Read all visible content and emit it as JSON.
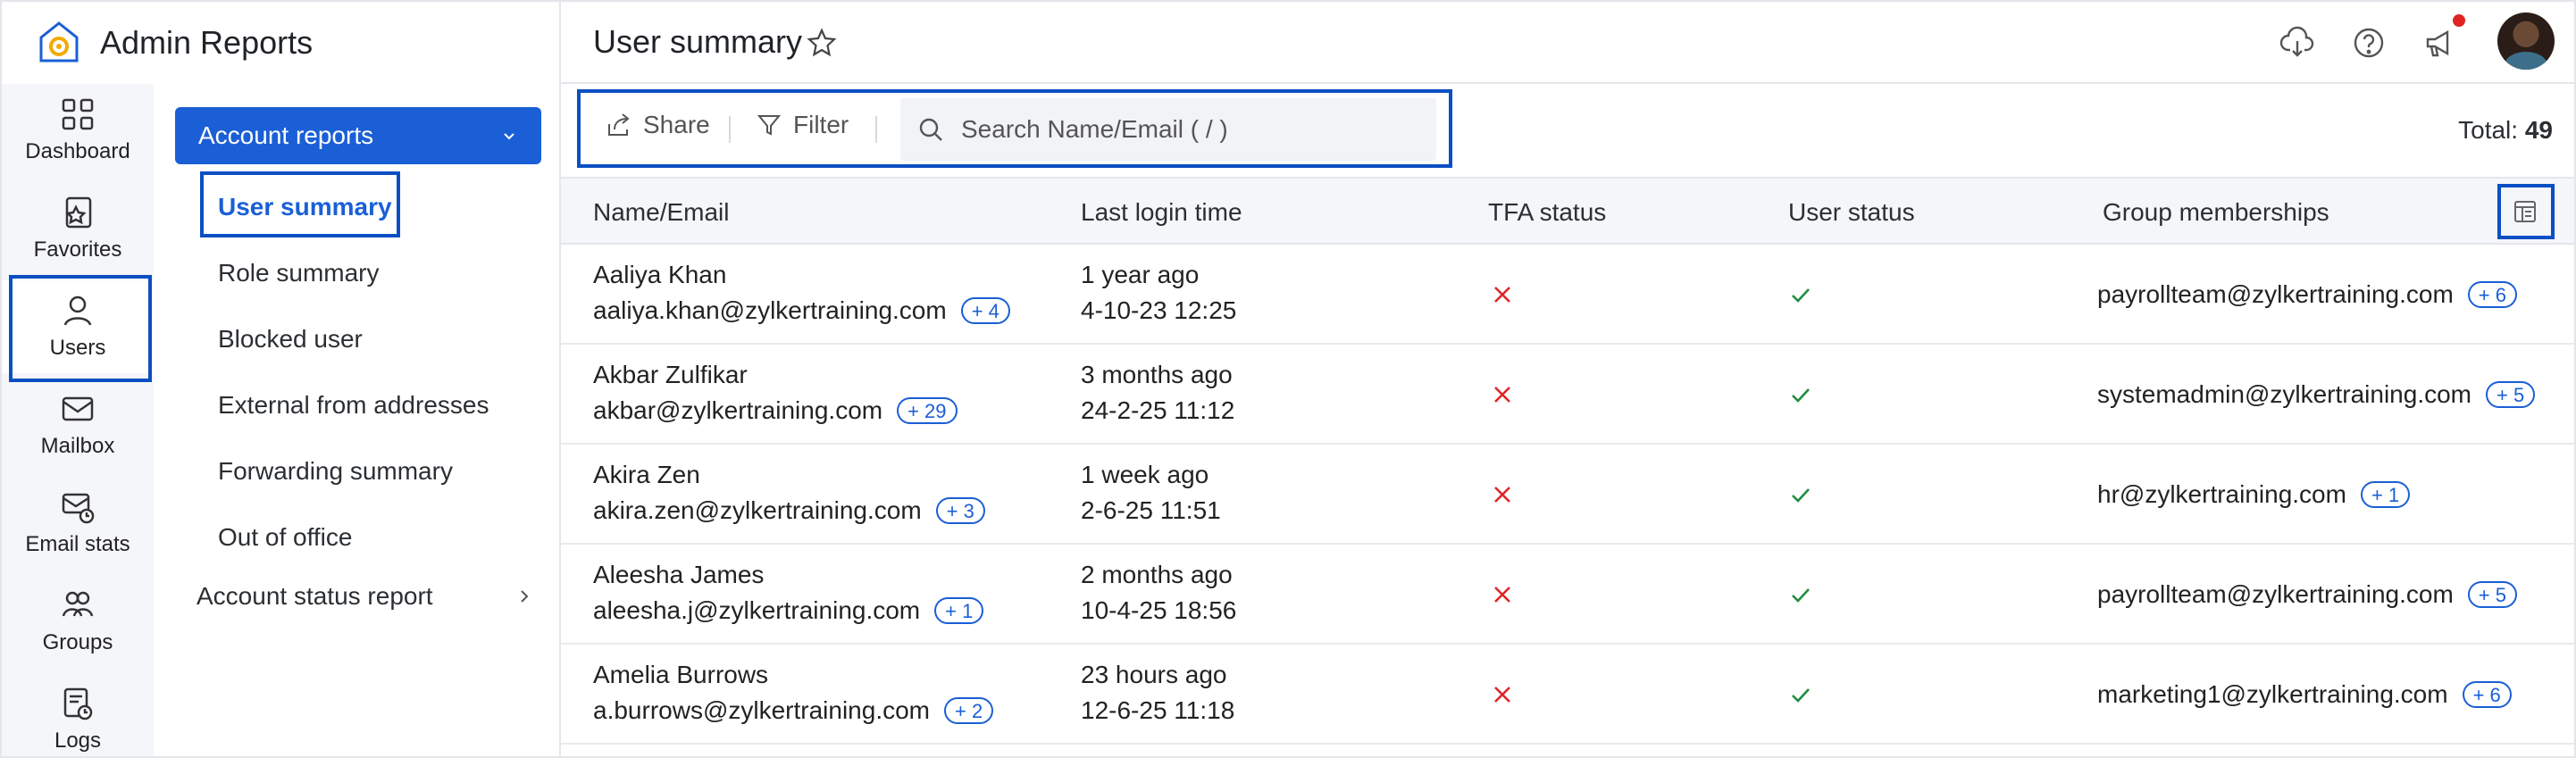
{
  "app": {
    "title": "Admin Reports"
  },
  "rail": [
    {
      "label": "Dashboard",
      "icon": "grid-icon"
    },
    {
      "label": "Favorites",
      "icon": "star-report-icon"
    },
    {
      "label": "Users",
      "icon": "user-icon"
    },
    {
      "label": "Mailbox",
      "icon": "mailbox-icon"
    },
    {
      "label": "Email stats",
      "icon": "email-stats-icon"
    },
    {
      "label": "Groups",
      "icon": "groups-icon"
    },
    {
      "label": "Logs",
      "icon": "logs-icon"
    }
  ],
  "subnav": {
    "section_label": "Account reports",
    "items": [
      {
        "label": "User summary"
      },
      {
        "label": "Role summary"
      },
      {
        "label": "Blocked user"
      },
      {
        "label": "External from addresses"
      },
      {
        "label": "Forwarding summary"
      },
      {
        "label": "Out of office"
      }
    ],
    "status_report_label": "Account status report"
  },
  "header": {
    "title": "User summary"
  },
  "toolbar": {
    "share_label": "Share",
    "filter_label": "Filter",
    "search_placeholder": "Search Name/Email ( / )",
    "total_label": "Total:",
    "total_value": "49"
  },
  "table": {
    "headers": [
      "Name/Email",
      "Last login time",
      "TFA status",
      "User status",
      "Group memberships"
    ],
    "rows": [
      {
        "name": "Aaliya Khan",
        "email": "aaliya.khan@zylkertraining.com",
        "email_more": "+ 4",
        "login_rel": "1 year ago",
        "login_abs": "4-10-23 12:25",
        "group": "payrollteam@zylkertraining.com",
        "group_more": "+ 6"
      },
      {
        "name": "Akbar Zulfikar",
        "email": "akbar@zylkertraining.com",
        "email_more": "+ 29",
        "login_rel": "3 months ago",
        "login_abs": "24-2-25 11:12",
        "group": "systemadmin@zylkertraining.com",
        "group_more": "+ 5"
      },
      {
        "name": "Akira Zen",
        "email": "akira.zen@zylkertraining.com",
        "email_more": "+ 3",
        "login_rel": "1 week ago",
        "login_abs": "2-6-25 11:51",
        "group": "hr@zylkertraining.com",
        "group_more": "+ 1"
      },
      {
        "name": "Aleesha James",
        "email": "aleesha.j@zylkertraining.com",
        "email_more": "+ 1",
        "login_rel": "2 months ago",
        "login_abs": "10-4-25 18:56",
        "group": "payrollteam@zylkertraining.com",
        "group_more": "+ 5"
      },
      {
        "name": "Amelia Burrows",
        "email": "a.burrows@zylkertraining.com",
        "email_more": "+ 2",
        "login_rel": "23 hours ago",
        "login_abs": "12-6-25 11:18",
        "group": "marketing1@zylkertraining.com",
        "group_more": "+ 6"
      }
    ]
  },
  "colors": {
    "accent": "#1a5fd6",
    "highlight_outline": "#0b4fc4",
    "tfa_off": "#e02424",
    "status_ok": "#1e8e3e"
  }
}
